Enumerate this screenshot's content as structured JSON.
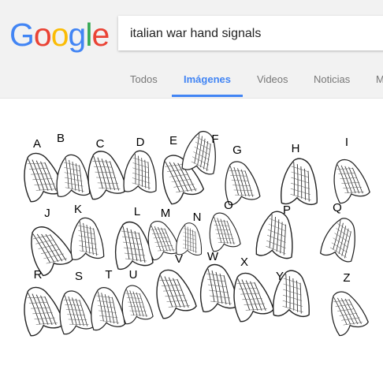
{
  "logo": {
    "letters": [
      {
        "ch": "G",
        "color": "#4285f4"
      },
      {
        "ch": "o",
        "color": "#ea4335"
      },
      {
        "ch": "o",
        "color": "#fbbc05"
      },
      {
        "ch": "g",
        "color": "#4285f4"
      },
      {
        "ch": "l",
        "color": "#34a853"
      },
      {
        "ch": "e",
        "color": "#ea4335"
      }
    ]
  },
  "search": {
    "query": "italian war hand signals"
  },
  "tabs": {
    "todos": "Todos",
    "imagenes": "Imágenes",
    "videos": "Videos",
    "noticias": "Noticias",
    "more": "M"
  },
  "colors": {
    "accent": "#4285f4",
    "header_bg": "#f2f2f2"
  },
  "image": {
    "content": "hand-gesture-illustrations",
    "letters": [
      "A",
      "B",
      "C",
      "D",
      "E",
      "F",
      "G",
      "H",
      "I",
      "J",
      "K",
      "L",
      "M",
      "N",
      "O",
      "P",
      "Q",
      "R",
      "S",
      "T",
      "U",
      "V",
      "W",
      "X",
      "Y",
      "Z"
    ]
  }
}
